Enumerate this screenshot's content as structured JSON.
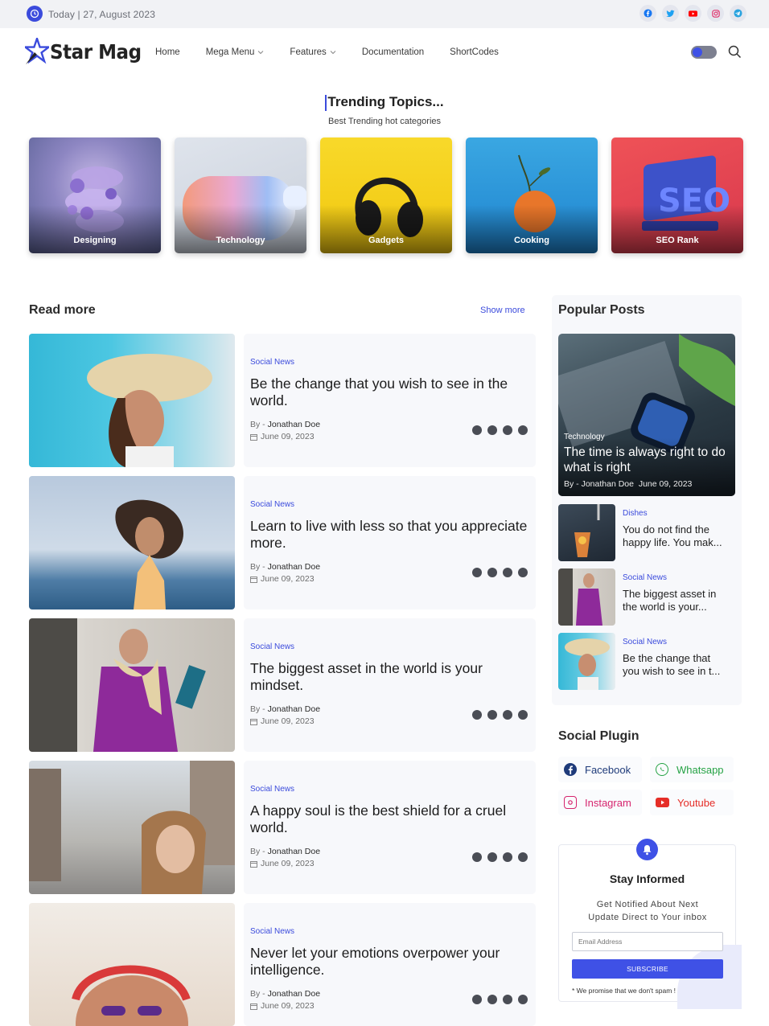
{
  "topbar": {
    "date": "Today | 27, August 2023",
    "socials": [
      {
        "name": "facebook-icon",
        "color": "#1877f2"
      },
      {
        "name": "twitter-icon",
        "color": "#1da1f2"
      },
      {
        "name": "youtube-icon",
        "color": "#ff0000"
      },
      {
        "name": "instagram-icon",
        "color": "#e1306c"
      },
      {
        "name": "telegram-icon",
        "color": "#2aa3df"
      }
    ]
  },
  "header": {
    "logo": "Star Mag",
    "nav": [
      "Home",
      "Mega Menu",
      "Features",
      "Documentation",
      "ShortCodes"
    ]
  },
  "trending": {
    "title": "Trending Topics...",
    "subtitle": "Best Trending hot categories",
    "categories": [
      "Designing",
      "Technology",
      "Gadgets",
      "Cooking",
      "SEO Rank"
    ]
  },
  "read_more": {
    "title": "Read more",
    "show_more": "Show more",
    "posts": [
      {
        "category": "Social News",
        "title": "Be the change that you wish to see in the world.",
        "by": "By -",
        "author": "Jonathan Doe",
        "date": "June 09, 2023"
      },
      {
        "category": "Social News",
        "title": "Learn to live with less so that you appreciate more.",
        "by": "By -",
        "author": "Jonathan Doe",
        "date": "June 09, 2023"
      },
      {
        "category": "Social News",
        "title": "The biggest asset in the world is your mindset.",
        "by": "By -",
        "author": "Jonathan Doe",
        "date": "June 09, 2023"
      },
      {
        "category": "Social News",
        "title": "A happy soul is the best shield for a cruel world.",
        "by": "By -",
        "author": "Jonathan Doe",
        "date": "June 09, 2023"
      },
      {
        "category": "Social News",
        "title": "Never let your emotions overpower your intelligence.",
        "by": "By -",
        "author": "Jonathan Doe",
        "date": "June 09, 2023"
      }
    ]
  },
  "popular": {
    "title": "Popular Posts",
    "main": {
      "category": "Technology",
      "title": "The time is always right to do what is right",
      "by": "By - Jonathan Doe",
      "date": "June 09, 2023"
    },
    "items": [
      {
        "category": "Dishes",
        "title_line1": "You do not find the",
        "title_line2": "happy life. You mak..."
      },
      {
        "category": "Social News",
        "title_line1": "The biggest asset in",
        "title_line2": "the world is your..."
      },
      {
        "category": "Social News",
        "title_line1": "Be the change that",
        "title_line2": "you wish to see in t..."
      }
    ]
  },
  "social_plugin": {
    "title": "Social Plugin",
    "items": [
      {
        "label": "Facebook",
        "color": "#1f3b7a"
      },
      {
        "label": "Whatsapp",
        "color": "#25a244"
      },
      {
        "label": "Instagram",
        "color": "#d6246e"
      },
      {
        "label": "Youtube",
        "color": "#e52d27"
      }
    ]
  },
  "newsletter": {
    "title": "Stay Informed",
    "desc_line1": "Get Notified About Next",
    "desc_line2": "Update Direct to Your inbox",
    "placeholder": "Email Address",
    "button": "SUBSCRIBE",
    "promise": "* We promise that we don't spam !"
  },
  "colors": {
    "accent": "#3b4bdc"
  }
}
